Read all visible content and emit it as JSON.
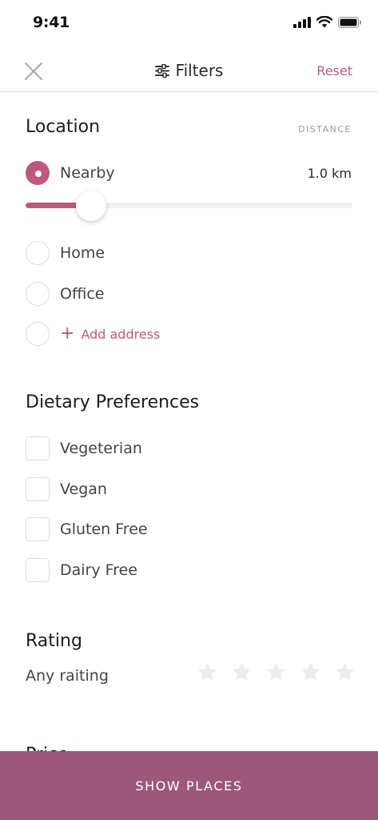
{
  "status_bar": {
    "time": "9:41"
  },
  "nav": {
    "title": "Filters",
    "reset_label": "Reset"
  },
  "location": {
    "title": "Location",
    "aside_label": "DISTANCE",
    "options": [
      {
        "label": "Nearby",
        "selected": true
      },
      {
        "label": "Home",
        "selected": false
      },
      {
        "label": "Office",
        "selected": false
      }
    ],
    "add_address_label": "Add address",
    "distance_value": "1.0 km",
    "slider_fraction": 0.2
  },
  "dietary": {
    "title": "Dietary Preferences",
    "options": [
      {
        "label": "Vegeterian",
        "checked": false
      },
      {
        "label": "Vegan",
        "checked": false
      },
      {
        "label": "Gluten Free",
        "checked": false
      },
      {
        "label": "Dairy Free",
        "checked": false
      }
    ]
  },
  "rating": {
    "title": "Rating",
    "label": "Any raiting",
    "stars_selected": 0,
    "star_count": 5
  },
  "next_section_title": "Price",
  "footer": {
    "button_label": "SHOW PLACES"
  },
  "colors": {
    "accent": "#c0577f",
    "footer_bg": "#9c5878",
    "star_inactive": "#ececec"
  }
}
